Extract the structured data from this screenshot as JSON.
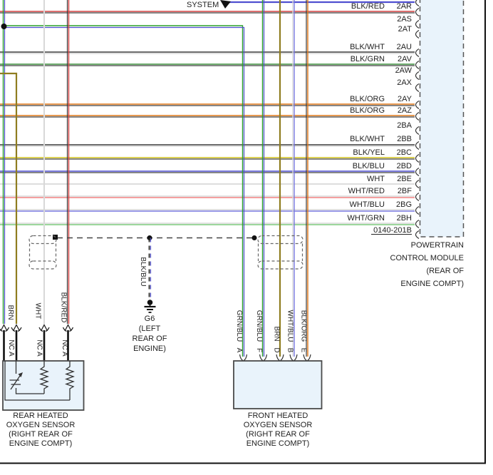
{
  "palette": {
    "red": "#d24040",
    "black_wire": "#3d3d3d",
    "white_wire": "#d8d8d8",
    "green": "#2ca02c",
    "dark_green": "#3f8f3f",
    "light_green": "#7cc87c",
    "brown": "#8f7d20",
    "yellow": "#d2c41e",
    "blue": "#4f4fd0",
    "light_blue_wire": "#7878e0",
    "orange": "#e07818",
    "salmon": "#f08080",
    "box_fill": "#e9f3fb",
    "box_border": "#4a4a4a",
    "frame": "#111111",
    "text": "#222222",
    "dash": "#555555"
  },
  "system": {
    "label": "SYSTEM"
  },
  "pcm": {
    "pins": [
      {
        "color": "BLK/RED",
        "pin": "2AR"
      },
      {
        "color": "",
        "pin": "2AS"
      },
      {
        "color": "",
        "pin": "2AT"
      },
      {
        "color": "BLK/WHT",
        "pin": "2AU"
      },
      {
        "color": "BLK/GRN",
        "pin": "2AV"
      },
      {
        "color": "",
        "pin": "2AW"
      },
      {
        "color": "",
        "pin": "2AX"
      },
      {
        "color": "BLK/ORG",
        "pin": "2AY"
      },
      {
        "color": "BLK/ORG",
        "pin": "2AZ"
      },
      {
        "color": "",
        "pin": "2BA"
      },
      {
        "color": "BLK/WHT",
        "pin": "2BB"
      },
      {
        "color": "BLK/YEL",
        "pin": "2BC"
      },
      {
        "color": "BLK/BLU",
        "pin": "2BD"
      },
      {
        "color": "WHT",
        "pin": "2BE"
      },
      {
        "color": "WHT/RED",
        "pin": "2BF"
      },
      {
        "color": "WHT/BLU",
        "pin": "2BG"
      },
      {
        "color": "WHT/GRN",
        "pin": "2BH"
      }
    ],
    "connector_ref": "0140-201B",
    "caption": [
      "POWERTRAIN",
      "CONTROL MODULE",
      "(REAR OF",
      "ENGINE COMPT)"
    ]
  },
  "ground": {
    "wire_color": "BLK/BLU",
    "caption": [
      "G6",
      "(LEFT",
      "REAR OF",
      "ENGINE)"
    ]
  },
  "front_sensor": {
    "pins": [
      {
        "pin": "A",
        "color": "GRN/BLU"
      },
      {
        "pin": "F",
        "color": "GRN/BLU"
      },
      {
        "pin": "D",
        "color": "BRN"
      },
      {
        "pin": "B",
        "color": "WHT/BLU"
      },
      {
        "pin": "E",
        "color": "BLK/ORG"
      }
    ],
    "caption": [
      "FRONT HEATED",
      "OXYGEN SENSOR",
      "(RIGHT REAR OF",
      "ENGINE COMPT)"
    ]
  },
  "rear_sensor": {
    "wires": [
      {
        "color": "BRN",
        "pin": "NC A"
      },
      {
        "color": "WHT",
        "pin": "NC A"
      },
      {
        "color": "BLK/RED",
        "pin": "NC A"
      }
    ],
    "caption": [
      "REAR HEATED",
      "OXYGEN SENSOR",
      "(RIGHT REAR OF",
      "ENGINE COMPT)"
    ]
  }
}
